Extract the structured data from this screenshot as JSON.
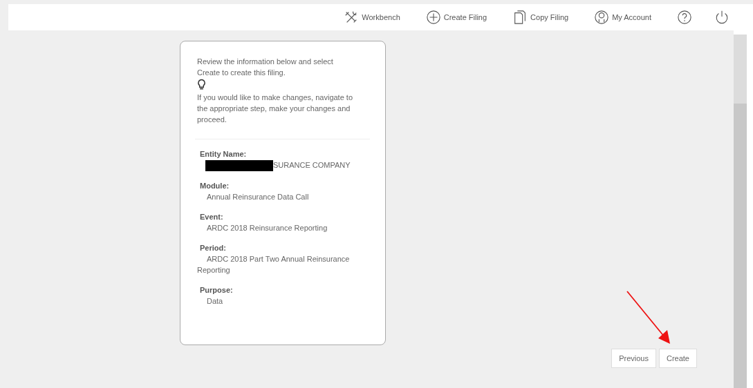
{
  "toolbar": {
    "items": [
      {
        "kind": "workbench",
        "label": "Workbench"
      },
      {
        "kind": "create",
        "label": "Create Filing"
      },
      {
        "kind": "copy",
        "label": "Copy Filing"
      },
      {
        "kind": "account",
        "label": "My Account"
      },
      {
        "kind": "help"
      },
      {
        "kind": "power"
      }
    ]
  },
  "card": {
    "intro": "Review the information below and select Create to create this filing.",
    "tip": "If you would like to make changes, navigate to the appropriate step, make your changes and proceed.",
    "fields": [
      {
        "label": "Entity Name:",
        "value": "SURANCE COMPANY",
        "redacted": true
      },
      {
        "label": "Module:",
        "value": "Annual Reinsurance Data Call",
        "redacted": false
      },
      {
        "label": "Event:",
        "value": "ARDC 2018 Reinsurance Reporting",
        "redacted": false
      },
      {
        "label": "Period:",
        "value": "ARDC 2018 Part Two Annual Reinsurance Reporting",
        "redacted": false
      },
      {
        "label": "Purpose:",
        "value": "Data",
        "redacted": false
      }
    ]
  },
  "buttons": [
    "Previous",
    "Create"
  ],
  "annotation": {
    "kind": "arrow"
  }
}
